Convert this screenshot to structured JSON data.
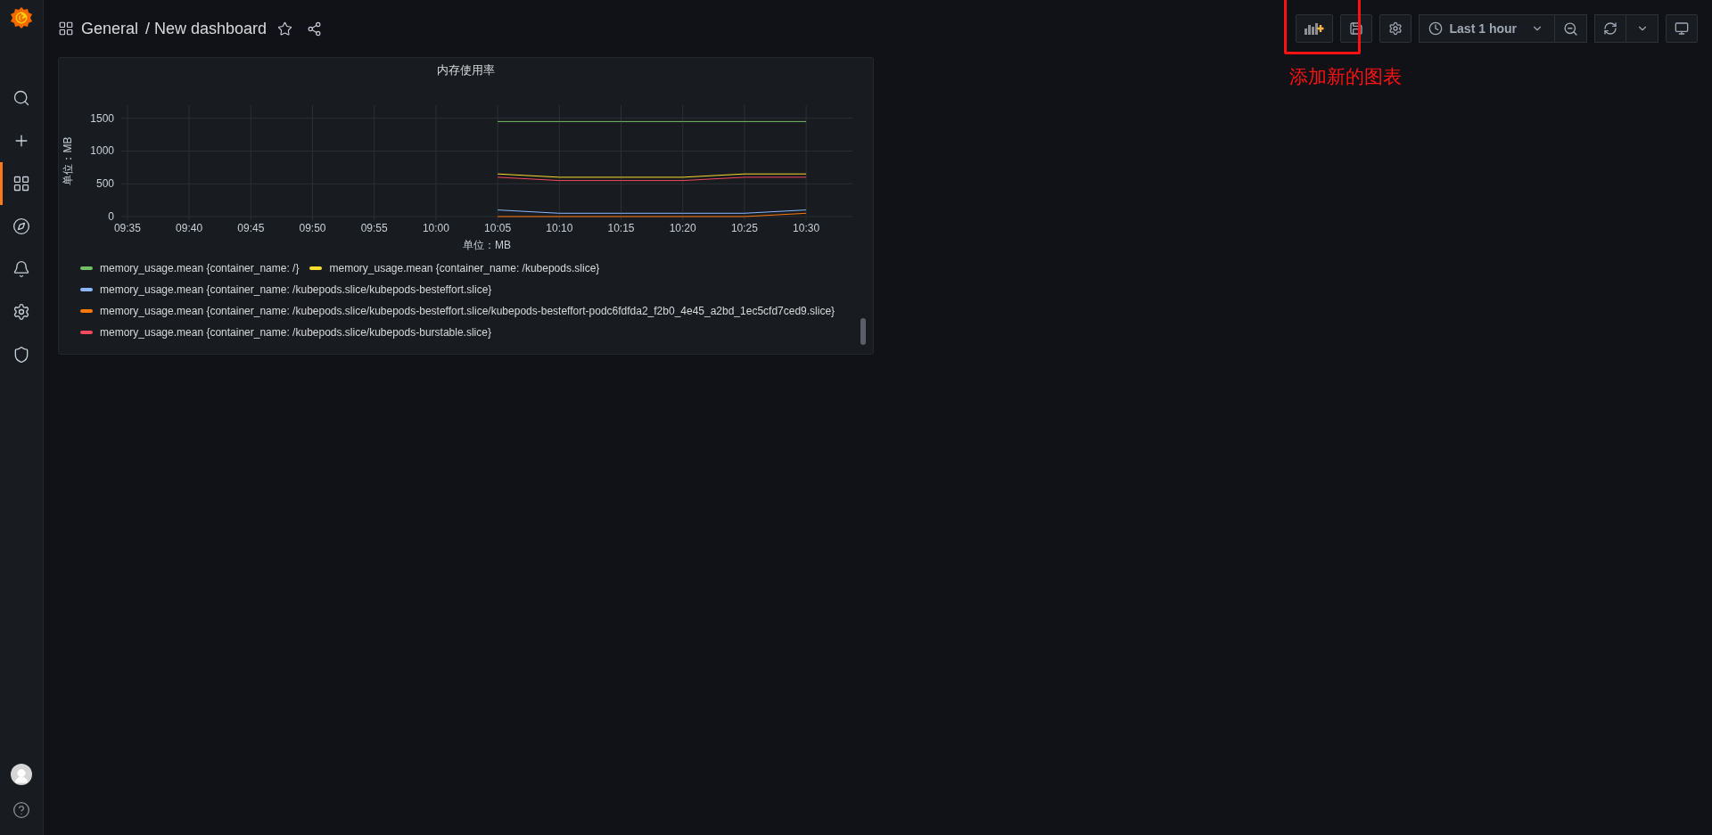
{
  "sidebar": {
    "items": [
      {
        "kind": "search",
        "selected": false
      },
      {
        "kind": "create",
        "selected": false
      },
      {
        "kind": "dashboards",
        "selected": true
      },
      {
        "kind": "explore",
        "selected": false
      },
      {
        "kind": "alerting",
        "selected": false
      },
      {
        "kind": "configuration",
        "selected": false
      },
      {
        "kind": "admin",
        "selected": false
      }
    ],
    "bottom_items": [
      {
        "kind": "profile"
      },
      {
        "kind": "help"
      }
    ]
  },
  "breadcrumb": {
    "folder": "General",
    "title": "/ New dashboard"
  },
  "toolbar": {
    "time_range": "Last 1 hour"
  },
  "annotation": {
    "text": "添加新的图表"
  },
  "panel": {
    "title": "内存使用率",
    "chart_data": {
      "type": "line",
      "xlabel": "单位：MB",
      "ylabel": "单位：MB",
      "categories": [
        "09:35",
        "09:40",
        "09:45",
        "09:50",
        "09:55",
        "10:00",
        "10:05",
        "10:10",
        "10:15",
        "10:20",
        "10:25",
        "10:30"
      ],
      "grid": true,
      "ylim": [
        0,
        1700
      ],
      "yticks": [
        0,
        500,
        1000,
        1500
      ],
      "series": [
        {
          "name": "memory_usage.mean {container_name: /}",
          "color": "#73bf69",
          "values": [
            null,
            null,
            null,
            null,
            null,
            null,
            1450,
            1450,
            1450,
            1450,
            1450,
            1450
          ]
        },
        {
          "name": "memory_usage.mean {container_name: /kubepods.slice}",
          "color": "#fade2a",
          "values": [
            null,
            null,
            null,
            null,
            null,
            null,
            650,
            600,
            600,
            600,
            650,
            650
          ]
        },
        {
          "name": "memory_usage.mean {container_name: /kubepods.slice/kubepods-besteffort.slice}",
          "color": "#8ab8ff",
          "values": [
            null,
            null,
            null,
            null,
            null,
            null,
            100,
            50,
            50,
            50,
            50,
            100
          ]
        },
        {
          "name": "memory_usage.mean {container_name: /kubepods.slice/kubepods-besteffort.slice/kubepods-besteffort-podc6fdfda2_f2b0_4e45_a2bd_1ec5cfd7ced9.slice}",
          "color": "#ff780a",
          "values": [
            null,
            null,
            null,
            null,
            null,
            null,
            0,
            0,
            0,
            0,
            0,
            50
          ]
        },
        {
          "name": "memory_usage.mean {container_name: /kubepods.slice/kubepods-burstable.slice}",
          "color": "#f2495c",
          "values": [
            null,
            null,
            null,
            null,
            null,
            null,
            600,
            550,
            550,
            550,
            600,
            600
          ]
        }
      ]
    }
  }
}
